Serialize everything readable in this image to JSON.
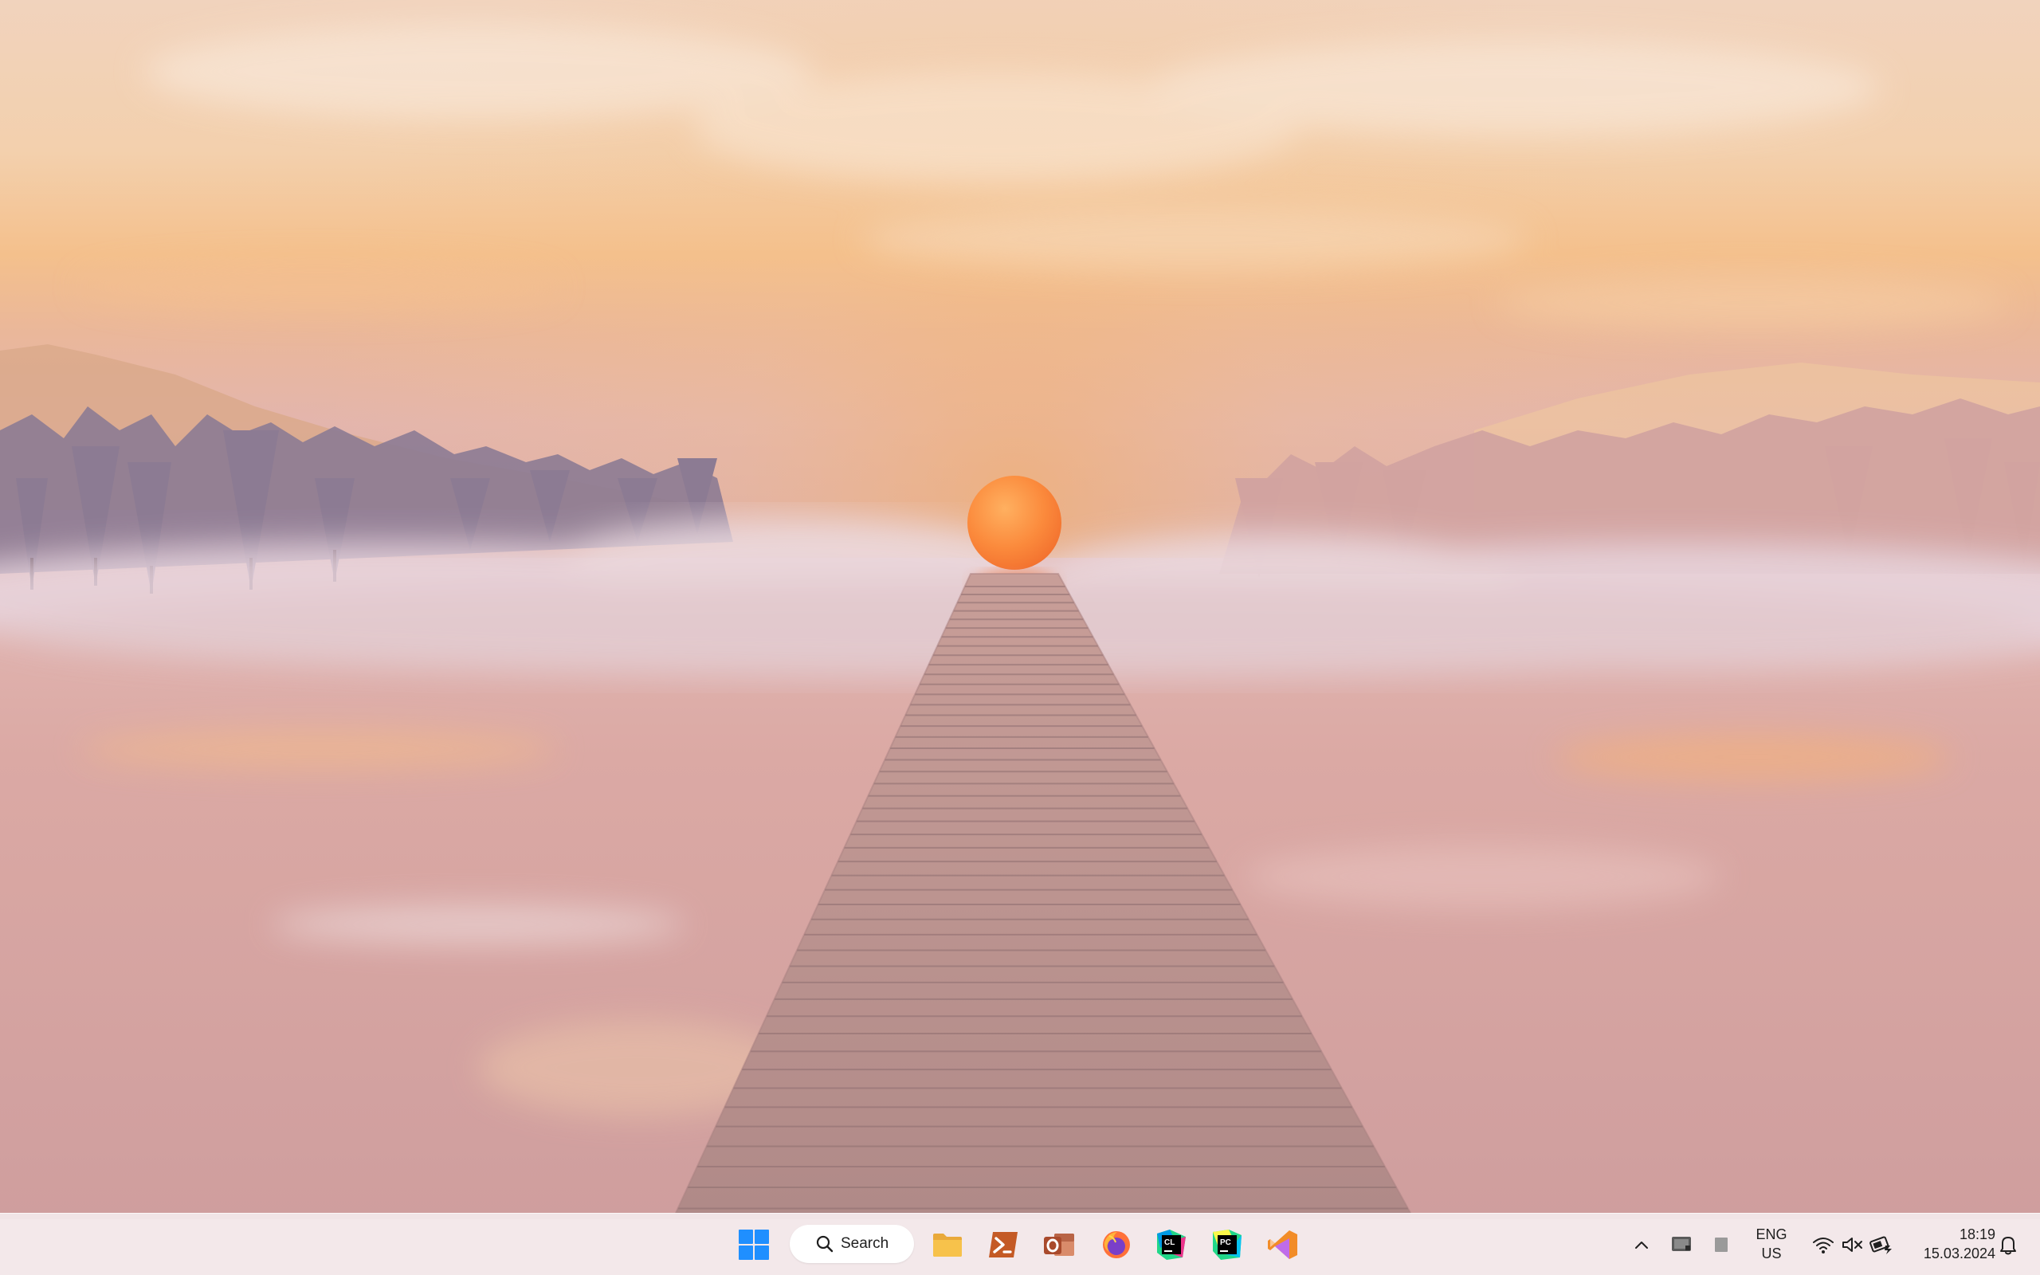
{
  "desktop": {
    "wallpaper_name": "misty-lake-sunset-boardwalk"
  },
  "taskbar": {
    "start_icon": "windows-logo-icon",
    "search": {
      "label": "Search",
      "icon": "search-icon"
    },
    "pinned_apps": [
      {
        "name": "file-explorer",
        "icon": "folder-icon"
      },
      {
        "name": "powershell",
        "icon": "terminal-icon"
      },
      {
        "name": "outlook",
        "icon": "outlook-icon"
      },
      {
        "name": "firefox",
        "icon": "firefox-icon"
      },
      {
        "name": "clion",
        "icon": "clion-icon",
        "badge": "CL"
      },
      {
        "name": "pycharm",
        "icon": "pycharm-icon",
        "badge": "PC"
      },
      {
        "name": "visual-studio",
        "icon": "visual-studio-icon"
      }
    ],
    "tray": {
      "overflow_icon": "chevron-up-icon",
      "language_line1": "ENG",
      "language_line2": "US",
      "time": "18:19",
      "date": "15.03.2024"
    }
  },
  "colors": {
    "windows_blue": "#1f8fff",
    "clion_green": "#21d789",
    "pycharm_green": "#21d789",
    "vs_purple": "#b968ff",
    "vs_orange": "#f28c28",
    "folder_yellow": "#f7c24b",
    "taskbar_bg": "#f3e7e9"
  }
}
